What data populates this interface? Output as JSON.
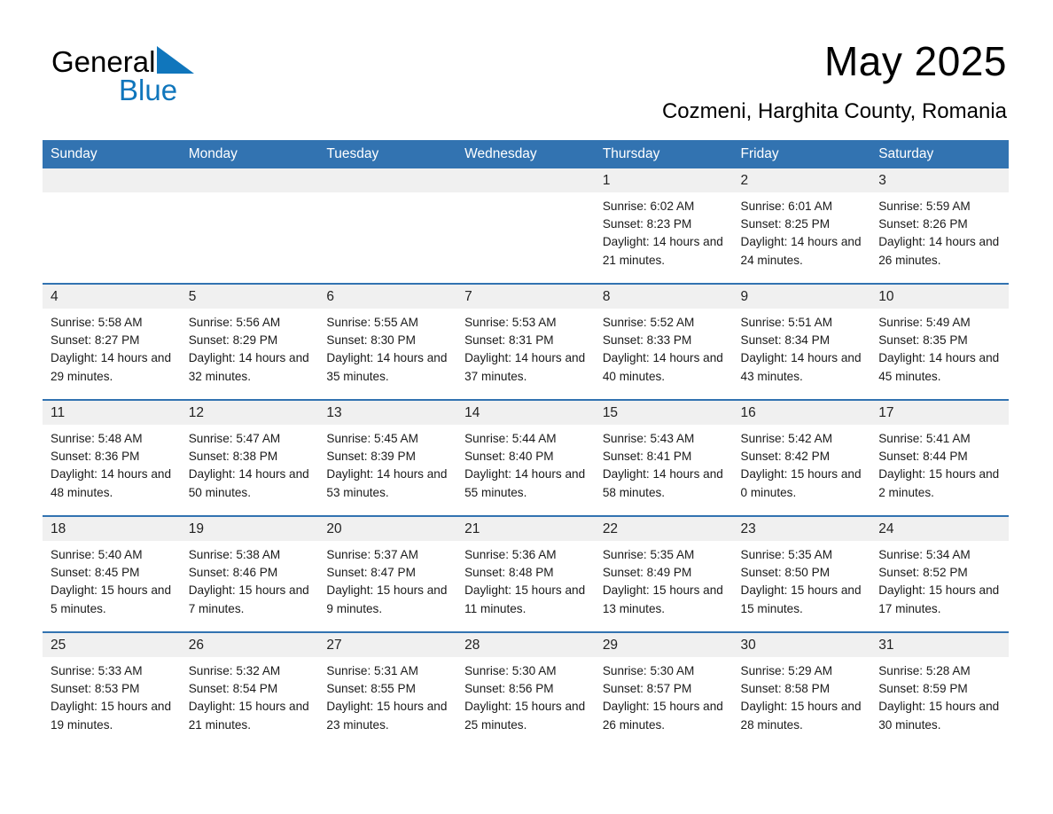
{
  "brand": {
    "name_part1": "General",
    "name_part2": "Blue",
    "triangle_color": "#1076bc",
    "text_color": "#000000"
  },
  "header": {
    "month_title": "May 2025",
    "location": "Cozmeni, Harghita County, Romania"
  },
  "calendar": {
    "accent_color": "#3273b1",
    "daynum_band_color": "#f0f0f0",
    "weekday_headers": [
      "Sunday",
      "Monday",
      "Tuesday",
      "Wednesday",
      "Thursday",
      "Friday",
      "Saturday"
    ],
    "weeks": [
      [
        {
          "day": "",
          "sunrise": "",
          "sunset": "",
          "daylight": ""
        },
        {
          "day": "",
          "sunrise": "",
          "sunset": "",
          "daylight": ""
        },
        {
          "day": "",
          "sunrise": "",
          "sunset": "",
          "daylight": ""
        },
        {
          "day": "",
          "sunrise": "",
          "sunset": "",
          "daylight": ""
        },
        {
          "day": "1",
          "sunrise": "Sunrise: 6:02 AM",
          "sunset": "Sunset: 8:23 PM",
          "daylight": "Daylight: 14 hours and 21 minutes."
        },
        {
          "day": "2",
          "sunrise": "Sunrise: 6:01 AM",
          "sunset": "Sunset: 8:25 PM",
          "daylight": "Daylight: 14 hours and 24 minutes."
        },
        {
          "day": "3",
          "sunrise": "Sunrise: 5:59 AM",
          "sunset": "Sunset: 8:26 PM",
          "daylight": "Daylight: 14 hours and 26 minutes."
        }
      ],
      [
        {
          "day": "4",
          "sunrise": "Sunrise: 5:58 AM",
          "sunset": "Sunset: 8:27 PM",
          "daylight": "Daylight: 14 hours and 29 minutes."
        },
        {
          "day": "5",
          "sunrise": "Sunrise: 5:56 AM",
          "sunset": "Sunset: 8:29 PM",
          "daylight": "Daylight: 14 hours and 32 minutes."
        },
        {
          "day": "6",
          "sunrise": "Sunrise: 5:55 AM",
          "sunset": "Sunset: 8:30 PM",
          "daylight": "Daylight: 14 hours and 35 minutes."
        },
        {
          "day": "7",
          "sunrise": "Sunrise: 5:53 AM",
          "sunset": "Sunset: 8:31 PM",
          "daylight": "Daylight: 14 hours and 37 minutes."
        },
        {
          "day": "8",
          "sunrise": "Sunrise: 5:52 AM",
          "sunset": "Sunset: 8:33 PM",
          "daylight": "Daylight: 14 hours and 40 minutes."
        },
        {
          "day": "9",
          "sunrise": "Sunrise: 5:51 AM",
          "sunset": "Sunset: 8:34 PM",
          "daylight": "Daylight: 14 hours and 43 minutes."
        },
        {
          "day": "10",
          "sunrise": "Sunrise: 5:49 AM",
          "sunset": "Sunset: 8:35 PM",
          "daylight": "Daylight: 14 hours and 45 minutes."
        }
      ],
      [
        {
          "day": "11",
          "sunrise": "Sunrise: 5:48 AM",
          "sunset": "Sunset: 8:36 PM",
          "daylight": "Daylight: 14 hours and 48 minutes."
        },
        {
          "day": "12",
          "sunrise": "Sunrise: 5:47 AM",
          "sunset": "Sunset: 8:38 PM",
          "daylight": "Daylight: 14 hours and 50 minutes."
        },
        {
          "day": "13",
          "sunrise": "Sunrise: 5:45 AM",
          "sunset": "Sunset: 8:39 PM",
          "daylight": "Daylight: 14 hours and 53 minutes."
        },
        {
          "day": "14",
          "sunrise": "Sunrise: 5:44 AM",
          "sunset": "Sunset: 8:40 PM",
          "daylight": "Daylight: 14 hours and 55 minutes."
        },
        {
          "day": "15",
          "sunrise": "Sunrise: 5:43 AM",
          "sunset": "Sunset: 8:41 PM",
          "daylight": "Daylight: 14 hours and 58 minutes."
        },
        {
          "day": "16",
          "sunrise": "Sunrise: 5:42 AM",
          "sunset": "Sunset: 8:42 PM",
          "daylight": "Daylight: 15 hours and 0 minutes."
        },
        {
          "day": "17",
          "sunrise": "Sunrise: 5:41 AM",
          "sunset": "Sunset: 8:44 PM",
          "daylight": "Daylight: 15 hours and 2 minutes."
        }
      ],
      [
        {
          "day": "18",
          "sunrise": "Sunrise: 5:40 AM",
          "sunset": "Sunset: 8:45 PM",
          "daylight": "Daylight: 15 hours and 5 minutes."
        },
        {
          "day": "19",
          "sunrise": "Sunrise: 5:38 AM",
          "sunset": "Sunset: 8:46 PM",
          "daylight": "Daylight: 15 hours and 7 minutes."
        },
        {
          "day": "20",
          "sunrise": "Sunrise: 5:37 AM",
          "sunset": "Sunset: 8:47 PM",
          "daylight": "Daylight: 15 hours and 9 minutes."
        },
        {
          "day": "21",
          "sunrise": "Sunrise: 5:36 AM",
          "sunset": "Sunset: 8:48 PM",
          "daylight": "Daylight: 15 hours and 11 minutes."
        },
        {
          "day": "22",
          "sunrise": "Sunrise: 5:35 AM",
          "sunset": "Sunset: 8:49 PM",
          "daylight": "Daylight: 15 hours and 13 minutes."
        },
        {
          "day": "23",
          "sunrise": "Sunrise: 5:35 AM",
          "sunset": "Sunset: 8:50 PM",
          "daylight": "Daylight: 15 hours and 15 minutes."
        },
        {
          "day": "24",
          "sunrise": "Sunrise: 5:34 AM",
          "sunset": "Sunset: 8:52 PM",
          "daylight": "Daylight: 15 hours and 17 minutes."
        }
      ],
      [
        {
          "day": "25",
          "sunrise": "Sunrise: 5:33 AM",
          "sunset": "Sunset: 8:53 PM",
          "daylight": "Daylight: 15 hours and 19 minutes."
        },
        {
          "day": "26",
          "sunrise": "Sunrise: 5:32 AM",
          "sunset": "Sunset: 8:54 PM",
          "daylight": "Daylight: 15 hours and 21 minutes."
        },
        {
          "day": "27",
          "sunrise": "Sunrise: 5:31 AM",
          "sunset": "Sunset: 8:55 PM",
          "daylight": "Daylight: 15 hours and 23 minutes."
        },
        {
          "day": "28",
          "sunrise": "Sunrise: 5:30 AM",
          "sunset": "Sunset: 8:56 PM",
          "daylight": "Daylight: 15 hours and 25 minutes."
        },
        {
          "day": "29",
          "sunrise": "Sunrise: 5:30 AM",
          "sunset": "Sunset: 8:57 PM",
          "daylight": "Daylight: 15 hours and 26 minutes."
        },
        {
          "day": "30",
          "sunrise": "Sunrise: 5:29 AM",
          "sunset": "Sunset: 8:58 PM",
          "daylight": "Daylight: 15 hours and 28 minutes."
        },
        {
          "day": "31",
          "sunrise": "Sunrise: 5:28 AM",
          "sunset": "Sunset: 8:59 PM",
          "daylight": "Daylight: 15 hours and 30 minutes."
        }
      ]
    ]
  }
}
